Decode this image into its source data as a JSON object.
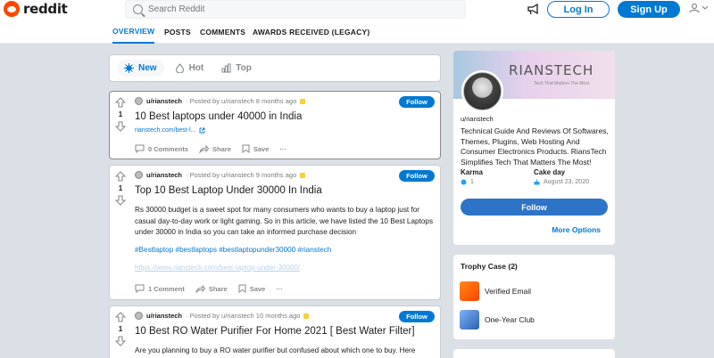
{
  "header": {
    "logo_text": "reddit",
    "search_placeholder": "Search Reddit",
    "login_label": "Log In",
    "signup_label": "Sign Up"
  },
  "tabs": [
    {
      "label": "OVERVIEW",
      "active": true
    },
    {
      "label": "POSTS",
      "active": false
    },
    {
      "label": "COMMENTS",
      "active": false
    },
    {
      "label": "AWARDS RECEIVED (LEGACY)",
      "active": false
    }
  ],
  "sort": [
    {
      "label": "New",
      "active": true
    },
    {
      "label": "Hot",
      "active": false
    },
    {
      "label": "Top",
      "active": false
    }
  ],
  "posts": [
    {
      "score": "1",
      "user": "u/rianstech",
      "posted": "· Posted by u/rianstech 8 months ago",
      "follow_label": "Follow",
      "title": "10 Best laptops under 40000 in India",
      "link": "rianstech.com/best-l...",
      "comments": "0 Comments",
      "share": "Share",
      "save": "Save"
    },
    {
      "score": "1",
      "user": "u/rianstech",
      "posted": "· Posted by u/rianstech 9 months ago",
      "follow_label": "Follow",
      "title": "Top 10 Best Laptop Under 30000 In India",
      "body": "Rs 30000 budget is a sweet spot for many consumers who wants to buy a laptop just for casual day-to-day work or light gaming. So in this article, we have listed the 10 Best Laptops under 30000 in India so you can take an informed purchase decision",
      "tags": "#Bestlaptop #bestlaptops #bestlaptopunder30000 #rianstech",
      "url": "https://www.rianstech.com/best-laptop-under-30000/",
      "comments": "1 Comment",
      "share": "Share",
      "save": "Save"
    },
    {
      "score": "1",
      "user": "u/rianstech",
      "posted": "· Posted by u/rianstech 10 months ago",
      "follow_label": "Follow",
      "title": "10 Best RO Water Purifier For Home 2021 [ Best Water Filter]",
      "body": "Are you planning to buy a RO water purifier but confused about which one to buy. Here"
    }
  ],
  "profile": {
    "banner_title": "RIANSTECH",
    "banner_sub": "Tech That Matters The Most",
    "username": "u/rianstech",
    "description": "Technical Guide And Reviews Of Softwares, Themes, Plugins, Web Hosting And Consumer Electronics Products. RiansTech Simplifies Tech That Matters The Most!",
    "karma_label": "Karma",
    "karma_value": "1",
    "cakeday_label": "Cake day",
    "cakeday_value": "August 23, 2020",
    "follow_label": "Follow",
    "more_options": "More Options"
  },
  "trophy_case": {
    "heading": "Trophy Case (2)",
    "items": [
      {
        "label": "Verified Email"
      },
      {
        "label": "One-Year Club"
      }
    ]
  },
  "colors": {
    "brand": "#ff4500",
    "accent": "#0079d3",
    "background": "#dae0e6"
  }
}
